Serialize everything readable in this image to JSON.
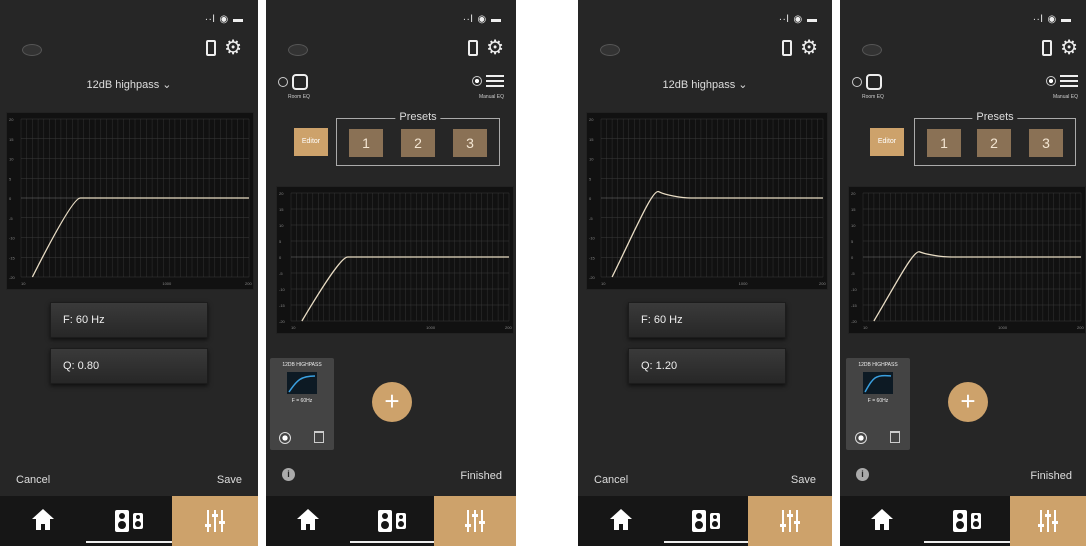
{
  "status_bar": "∙∙l ◉ ▬",
  "icons": {
    "device": "phone-icon",
    "settings": "gear-icon",
    "home": "home-icon",
    "speakers": "speaker-icon",
    "eq": "equalizer-icon",
    "info": "info-icon",
    "trash": "trash-icon",
    "add": "plus-icon"
  },
  "colors": {
    "accent": "#cda26b",
    "preset": "#8a7155",
    "background": "#262626",
    "curve": "#e8dcc4"
  },
  "filter_screens": [
    {
      "title": "12dB highpass ⌄",
      "frequency": "F: 60 Hz",
      "q": "Q: 0.80",
      "cancel": "Cancel",
      "save": "Save"
    },
    {
      "title": "12dB highpass ⌄",
      "frequency": "F: 60 Hz",
      "q": "Q: 1.20",
      "cancel": "Cancel",
      "save": "Save"
    }
  ],
  "eq_screens": [
    {
      "room_eq": "Room EQ",
      "manual_eq": "Manual EQ",
      "editor": "Editor",
      "presets_label": "Presets",
      "presets": [
        "1",
        "2",
        "3"
      ],
      "card_title": "12DB HIGHPASS",
      "card_sub": "F = 60Hz",
      "add": "+",
      "info": "i",
      "finished": "Finished"
    },
    {
      "room_eq": "Room EQ",
      "manual_eq": "Manual EQ",
      "editor": "Editor",
      "presets_label": "Presets",
      "presets": [
        "1",
        "2",
        "3"
      ],
      "card_title": "12DB HIGHPASS",
      "card_sub": "F = 60Hz",
      "add": "+",
      "info": "i",
      "finished": "Finished"
    }
  ],
  "chart_data": [
    {
      "type": "line",
      "xlabels": [
        "10",
        "1000",
        "200"
      ],
      "ylabels": [
        "20",
        "15",
        "10",
        "5",
        "0",
        "-5",
        "-10",
        "-15",
        "-20"
      ],
      "series": [
        {
          "values_shape": "highpass",
          "q": 0.8
        }
      ]
    },
    {
      "type": "line",
      "xlabels": [
        "10",
        "1000",
        "200"
      ],
      "ylabels": [
        "20",
        "15",
        "10",
        "5",
        "0",
        "-5",
        "-10",
        "-15",
        "-20"
      ],
      "series": [
        {
          "values_shape": "highpass",
          "q": 0.8
        }
      ]
    },
    {
      "type": "line",
      "xlabels": [
        "10",
        "1000",
        "200"
      ],
      "ylabels": [
        "20",
        "15",
        "10",
        "5",
        "0",
        "-5",
        "-10",
        "-15",
        "-20"
      ],
      "series": [
        {
          "values_shape": "highpass",
          "q": 1.2
        }
      ]
    },
    {
      "type": "line",
      "xlabels": [
        "10",
        "1000",
        "200"
      ],
      "ylabels": [
        "20",
        "15",
        "10",
        "5",
        "0",
        "-5",
        "-10",
        "-15",
        "-20"
      ],
      "series": [
        {
          "values_shape": "highpass",
          "q": 1.2
        }
      ]
    }
  ]
}
